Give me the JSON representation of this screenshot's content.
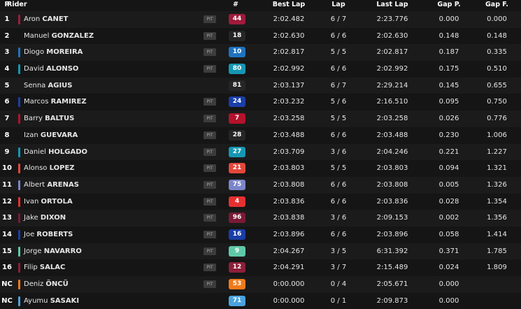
{
  "headers": {
    "pos": "P",
    "rider": "Rider",
    "num": "#",
    "best": "Best Lap",
    "lap": "Lap",
    "last": "Last Lap",
    "gapp": "Gap P.",
    "gapf": "Gap F."
  },
  "rows": [
    {
      "pos": "1",
      "first": "Aron",
      "last": "CANET",
      "pit": "PIT",
      "num": "44",
      "color": "#9e1b3b",
      "best": "2:02.482",
      "lap": "6 / 7",
      "lastlap": "2:23.776",
      "gapp": "0.000",
      "gapf": "0.000"
    },
    {
      "pos": "2",
      "first": "Manuel",
      "last": "GONZALEZ",
      "pit": "PIT",
      "num": "18",
      "color": "#262626",
      "best": "2:02.630",
      "lap": "6 / 6",
      "lastlap": "2:02.630",
      "gapp": "0.148",
      "gapf": "0.148"
    },
    {
      "pos": "3",
      "first": "Diogo",
      "last": "MOREIRA",
      "pit": "PIT",
      "num": "10",
      "color": "#1e73be",
      "best": "2:02.817",
      "lap": "5 / 5",
      "lastlap": "2:02.817",
      "gapp": "0.187",
      "gapf": "0.335"
    },
    {
      "pos": "4",
      "first": "David",
      "last": "ALONSO",
      "pit": "PIT",
      "num": "80",
      "color": "#1597b3",
      "best": "2:02.992",
      "lap": "6 / 6",
      "lastlap": "2:02.992",
      "gapp": "0.175",
      "gapf": "0.510"
    },
    {
      "pos": "5",
      "first": "Senna",
      "last": "AGIUS",
      "pit": "",
      "num": "81",
      "color": "#262626",
      "best": "2:03.137",
      "lap": "6 / 7",
      "lastlap": "2:29.214",
      "gapp": "0.145",
      "gapf": "0.655"
    },
    {
      "pos": "6",
      "first": "Marcos",
      "last": "RAMIREZ",
      "pit": "PIT",
      "num": "24",
      "color": "#1a3ea8",
      "best": "2:03.232",
      "lap": "5 / 6",
      "lastlap": "2:16.510",
      "gapp": "0.095",
      "gapf": "0.750"
    },
    {
      "pos": "7",
      "first": "Barry",
      "last": "BALTUS",
      "pit": "PIT",
      "num": "7",
      "color": "#b3122c",
      "best": "2:03.258",
      "lap": "5 / 5",
      "lastlap": "2:03.258",
      "gapp": "0.026",
      "gapf": "0.776"
    },
    {
      "pos": "8",
      "first": "Izan",
      "last": "GUEVARA",
      "pit": "PIT",
      "num": "28",
      "color": "#262626",
      "best": "2:03.488",
      "lap": "6 / 6",
      "lastlap": "2:03.488",
      "gapp": "0.230",
      "gapf": "1.006"
    },
    {
      "pos": "9",
      "first": "Daniel",
      "last": "HOLGADO",
      "pit": "PIT",
      "num": "27",
      "color": "#1597b3",
      "best": "2:03.709",
      "lap": "3 / 6",
      "lastlap": "2:04.246",
      "gapp": "0.221",
      "gapf": "1.227"
    },
    {
      "pos": "10",
      "first": "Alonso",
      "last": "LOPEZ",
      "pit": "PIT",
      "num": "21",
      "color": "#e3473b",
      "best": "2:03.803",
      "lap": "5 / 5",
      "lastlap": "2:03.803",
      "gapp": "0.094",
      "gapf": "1.321"
    },
    {
      "pos": "11",
      "first": "Albert",
      "last": "ARENAS",
      "pit": "PIT",
      "num": "75",
      "color": "#7b86c9",
      "best": "2:03.808",
      "lap": "6 / 6",
      "lastlap": "2:03.808",
      "gapp": "0.005",
      "gapf": "1.326"
    },
    {
      "pos": "12",
      "first": "Ivan",
      "last": "ORTOLA",
      "pit": "PIT",
      "num": "4",
      "color": "#e53030",
      "best": "2:03.836",
      "lap": "6 / 6",
      "lastlap": "2:03.836",
      "gapp": "0.028",
      "gapf": "1.354"
    },
    {
      "pos": "13",
      "first": "Jake",
      "last": "DIXON",
      "pit": "PIT",
      "num": "96",
      "color": "#7a1a36",
      "best": "2:03.838",
      "lap": "3 / 6",
      "lastlap": "2:09.153",
      "gapp": "0.002",
      "gapf": "1.356"
    },
    {
      "pos": "14",
      "first": "Joe",
      "last": "ROBERTS",
      "pit": "PIT",
      "num": "16",
      "color": "#1a3ea8",
      "best": "2:03.896",
      "lap": "6 / 6",
      "lastlap": "2:03.896",
      "gapp": "0.058",
      "gapf": "1.414"
    },
    {
      "pos": "15",
      "first": "Jorge",
      "last": "NAVARRO",
      "pit": "PIT",
      "num": "9",
      "color": "#5fc9a7",
      "best": "2:04.267",
      "lap": "3 / 5",
      "lastlap": "6:31.392",
      "gapp": "0.371",
      "gapf": "1.785"
    },
    {
      "pos": "16",
      "first": "Filip",
      "last": "SALAC",
      "pit": "PIT",
      "num": "12",
      "color": "#8c1f3a",
      "best": "2:04.291",
      "lap": "3 / 7",
      "lastlap": "2:15.489",
      "gapp": "0.024",
      "gapf": "1.809"
    },
    {
      "pos": "NC",
      "first": "Deniz",
      "last": "ÖNCÜ",
      "pit": "PIT",
      "num": "53",
      "color": "#f07a1a",
      "best": "0:00.000",
      "lap": "0 / 4",
      "lastlap": "2:05.671",
      "gapp": "0.000",
      "gapf": ""
    },
    {
      "pos": "NC",
      "first": "Ayumu",
      "last": "SASAKI",
      "pit": "",
      "num": "71",
      "color": "#4aa3df",
      "best": "0:00.000",
      "lap": "0 / 1",
      "lastlap": "2:09.873",
      "gapp": "0.000",
      "gapf": ""
    }
  ]
}
